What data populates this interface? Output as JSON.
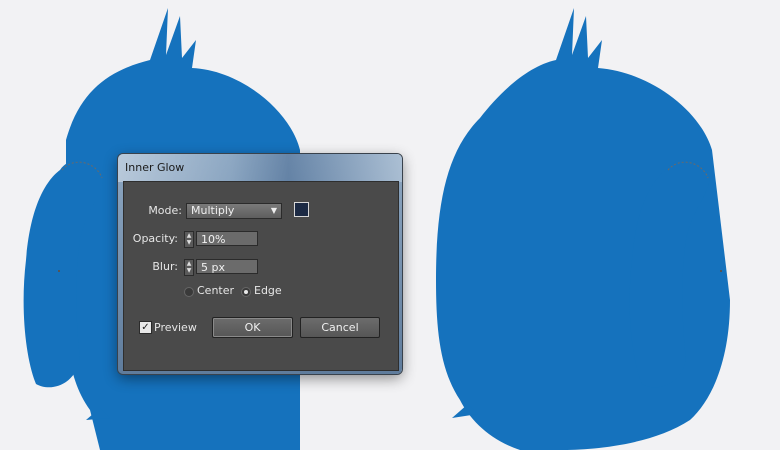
{
  "dialog": {
    "title": "Inner Glow",
    "mode_label": "Mode:",
    "mode_value": "Multiply",
    "mode_color": "#1c2a44",
    "opacity_label": "Opacity:",
    "opacity_value": "10%",
    "blur_label": "Blur:",
    "blur_value": "5 px",
    "center_label": "Center",
    "edge_label": "Edge",
    "edge_selected": true,
    "preview_label": "Preview",
    "preview_checked": true,
    "ok_label": "OK",
    "cancel_label": "Cancel"
  },
  "artwork": {
    "monster_color": "#1572bd",
    "items": [
      "monster-left",
      "monster-right"
    ]
  }
}
